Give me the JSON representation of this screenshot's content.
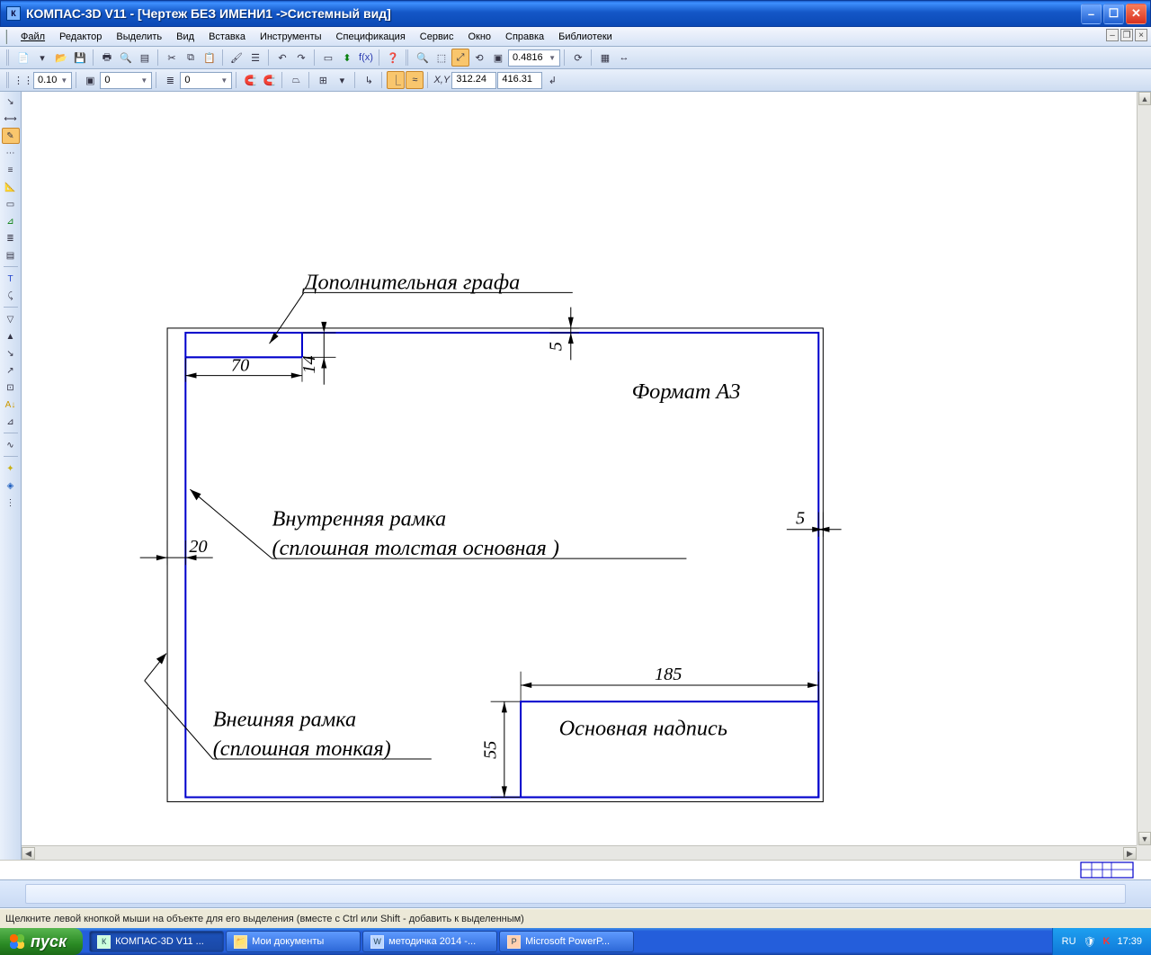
{
  "window": {
    "title": "КОМПАС-3D V11 - [Чертеж БЕЗ ИМЕНИ1 ->Системный вид]"
  },
  "menu": {
    "file": "Файл",
    "edit": "Редактор",
    "select": "Выделить",
    "view": "Вид",
    "insert": "Вставка",
    "tools": "Инструменты",
    "spec": "Спецификация",
    "service": "Сервис",
    "window": "Окно",
    "help": "Справка",
    "libs": "Библиотеки"
  },
  "toolbar1": {
    "zoom_value": "0.4816"
  },
  "toolbar2": {
    "step": "0.10",
    "layer_a": "0",
    "layer_b": "0",
    "x": "312.24",
    "y": "416.31"
  },
  "drawing": {
    "label_extra": "Дополнительная графа",
    "label_format": "Формат А3",
    "label_innerframe1": "Внутренняя рамка",
    "label_innerframe2": "(сплошная толстая основная )",
    "label_outerframe1": "Внешняя рамка",
    "label_outerframe2": "(сплошная тонкая)",
    "label_titleblock": "Основная надпись",
    "dim_70": "70",
    "dim_14": "14",
    "dim_5a": "5",
    "dim_5b": "5",
    "dim_20": "20",
    "dim_185": "185",
    "dim_55": "55"
  },
  "status": {
    "text": "Щелкните левой кнопкой мыши на объекте для его выделения (вместе с Ctrl или Shift - добавить к выделенным)"
  },
  "taskbar": {
    "start": "пуск",
    "tasks": [
      {
        "label": "КОМПАС-3D V11 ..."
      },
      {
        "label": "Мои документы"
      },
      {
        "label": "методичка 2014 -..."
      },
      {
        "label": "Microsoft PowerP..."
      }
    ],
    "lang": "RU",
    "time": "17:39"
  }
}
